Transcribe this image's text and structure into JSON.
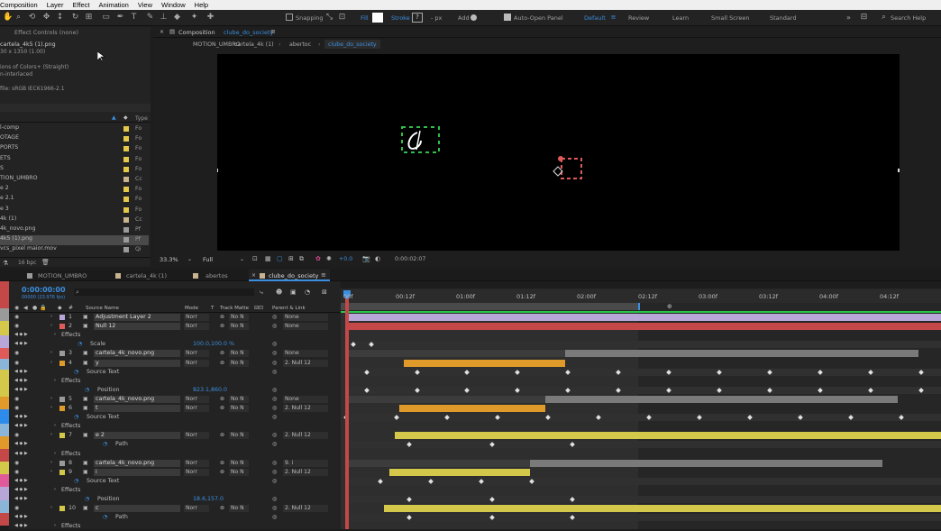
{
  "menu": [
    "Composition",
    "Layer",
    "Effect",
    "Animation",
    "View",
    "Window",
    "Help"
  ],
  "toolbar": {
    "snapping": "Snapping",
    "fill": "Fill",
    "stroke": "Stroke",
    "px": "- px",
    "add": "Add",
    "auto_open": "Auto-Open Panel",
    "workspaces": [
      "Default",
      "Review",
      "Learn",
      "Small Screen",
      "Standard"
    ],
    "search": "Search Help"
  },
  "effect_controls": "Effect Controls (none)",
  "file_info": {
    "name": "cartela_4k5 (1).png",
    "dims": "30 x 1350 (1.00)",
    "colors": "ions of Colors+ (Straight)",
    "interlace": "n-interlaced",
    "profile": "file: sRGB IEC61966-2.1"
  },
  "project": {
    "col_type": "Type",
    "items": [
      {
        "name": "l-comp",
        "type": "Fo",
        "color": "#e4c84a"
      },
      {
        "name": "OTAGE",
        "type": "Fo",
        "color": "#e4c84a"
      },
      {
        "name": "PORTS",
        "type": "Fo",
        "color": "#e4c84a"
      },
      {
        "name": "ETS",
        "type": "Fo",
        "color": "#e4c84a"
      },
      {
        "name": "S",
        "type": "Fo",
        "color": "#e4c84a"
      },
      {
        "name": "TION_UMBRO",
        "type": "Cc",
        "color": "#c8b48e"
      },
      {
        "name": "e 2",
        "type": "Fo",
        "color": "#e4c84a"
      },
      {
        "name": "e 2.1",
        "type": "Fo",
        "color": "#e4c84a"
      },
      {
        "name": "e 3",
        "type": "Fo",
        "color": "#e4c84a"
      },
      {
        "name": "4k (1)",
        "type": "Cc",
        "color": "#c8b48e"
      },
      {
        "name": "4k_novo.png",
        "type": "Pf",
        "color": "#9a9a9a"
      },
      {
        "name": "4k5 (1).png",
        "type": "Pf",
        "color": "#9a9a9a"
      },
      {
        "name": "vcs_pixel maior.mov",
        "type": "Qi",
        "color": "#9a9a9a"
      }
    ],
    "bpc": "16 bpc"
  },
  "comp_panel": {
    "label": "Composition",
    "comp_name": "clube_do_society",
    "breadcrumbs": [
      "MOTION_UMBRO",
      "cartela_4k (1)",
      "abertoc",
      "clube_do_society"
    ],
    "zoom": "33.3%",
    "res": "Full",
    "exposure": "+0.0",
    "timecode": "0:00:02:07"
  },
  "tl_tabs": [
    "MOTION_UMBRO",
    "cartela_4k (1)",
    "abertos",
    "clube_do_society"
  ],
  "tl_time": "0:00:00:00",
  "tl_frames": "00000 (23.976 fps)",
  "tl_cols": {
    "source": "Source Name",
    "mode": "Mode",
    "t": "T",
    "trkmat": "Track Matte",
    "parent": "Parent & Link"
  },
  "ruler": [
    "00f",
    "00:12f",
    "01:00f",
    "01:12f",
    "02:00f",
    "02:12f",
    "03:00f",
    "03:12f",
    "04:00f",
    "04:12f"
  ],
  "layers": [
    {
      "n": "1",
      "name": "Adjustment Layer 2",
      "mode": "Norr",
      "mat": "No N",
      "par": "None",
      "color": "#b8a6d8"
    },
    {
      "n": "2",
      "name": "Null 12",
      "mode": "Norr",
      "mat": "No N",
      "par": "None",
      "color": "#e05a5a"
    },
    {
      "n": "3",
      "name": "cartela_4k_novo.png",
      "mode": "Norr",
      "mat": "No N",
      "par": "None",
      "color": "#9a9a9a"
    },
    {
      "n": "4",
      "name": "y",
      "mode": "Norr",
      "mat": "No N",
      "par": "2. Null 12",
      "color": "#e09a2a"
    },
    {
      "n": "5",
      "name": "cartela_4k_novo.png",
      "mode": "Norr",
      "mat": "No N",
      "par": "None",
      "color": "#9a9a9a"
    },
    {
      "n": "6",
      "name": "t",
      "mode": "Norr",
      "mat": "No N",
      "par": "2. Null 12",
      "color": "#e09a2a"
    },
    {
      "n": "7",
      "name": "e 2",
      "mode": "Norr",
      "mat": "No N",
      "par": "2. Null 12",
      "color": "#d4c84a"
    },
    {
      "n": "8",
      "name": "cartela_4k_novo.png",
      "mode": "Norr",
      "mat": "No N",
      "par": "9. i",
      "color": "#9a9a9a"
    },
    {
      "n": "9",
      "name": "i",
      "mode": "Norr",
      "mat": "No N",
      "par": "2. Null 12",
      "color": "#d4c84a"
    },
    {
      "n": "10",
      "name": "c",
      "mode": "Norr",
      "mat": "No N",
      "par": "2. Null 12",
      "color": "#d4c84a"
    }
  ],
  "props": {
    "effects": "Effects",
    "scale": "Scale",
    "scale_val": "100.0,100.0 %",
    "source_text": "Source Text",
    "position": "Position",
    "pos_val1": "823.1,860.0",
    "pos_val2": "18.6,157.0",
    "path": "Path"
  },
  "colors": {
    "yellow": "#d4c84a",
    "orange": "#e09a2a",
    "gray": "#7a7a7a",
    "lavender": "#b8a6d8",
    "red": "#c44848",
    "blue": "#2d8ceb",
    "green": "#27c64a"
  }
}
